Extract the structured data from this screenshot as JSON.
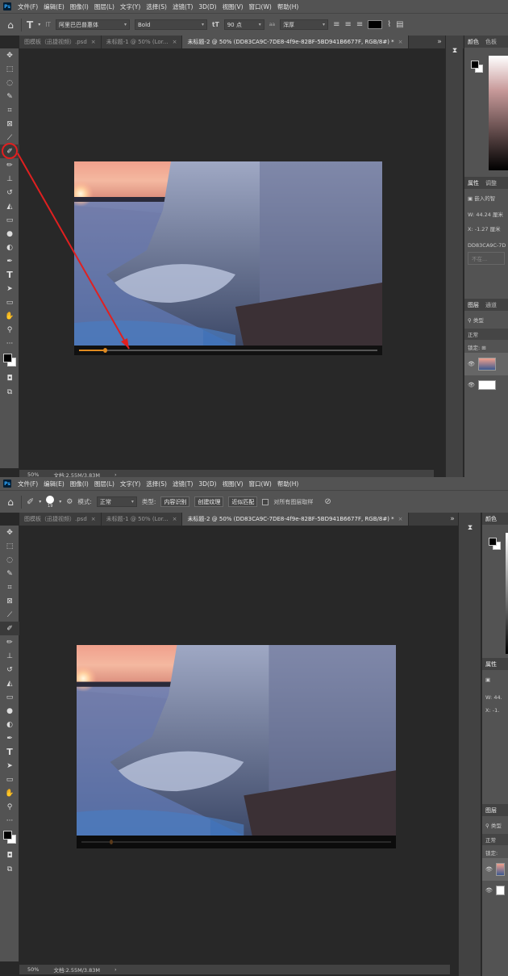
{
  "app": {
    "logo": "Ps"
  },
  "menu": [
    "文件(F)",
    "编辑(E)",
    "图像(I)",
    "图层(L)",
    "文字(Y)",
    "选择(S)",
    "滤镜(T)",
    "3D(D)",
    "视图(V)",
    "窗口(W)",
    "帮助(H)"
  ],
  "text_options": {
    "tool_icon": "T",
    "orient_icon": "IT",
    "font_family": "阿里巴巴普惠体",
    "font_style": "Bold",
    "font_size_icon": "tT",
    "font_size": "90 点",
    "aa_icon": "aa",
    "antialias": "浑厚"
  },
  "heal_options": {
    "brush_size": "19",
    "mode_label": "模式:",
    "mode": "正常",
    "type_label": "类型:",
    "type_buttons": [
      "内容识别",
      "创建纹理",
      "近似匹配"
    ],
    "sample_all": "对所有图层取样"
  },
  "tabs_top": [
    {
      "label": "图模板（迅捷视频）.psd",
      "active": false
    },
    {
      "label": "未标题-1 @ 50% (Lor...",
      "active": false
    },
    {
      "label": "未标题-2 @ 50% (DD83CA9C-7DE8-4f9e-82BF-5BD941B6677F, RGB/8#) *",
      "active": true
    }
  ],
  "tabs_bottom": [
    {
      "label": "图模板（迅捷视频）.psd",
      "active": false
    },
    {
      "label": "未标题-1 @ 50% (Lor...",
      "active": false
    },
    {
      "label": "未标题-2 @ 50% (DD83CA9C-7DE8-4f9e-82BF-5BD941B6677F, RGB/8#) *",
      "active": true
    }
  ],
  "tabs_overflow": "»",
  "status": {
    "zoom": "50%",
    "doc": "文档:2.55M/3.83M"
  },
  "panels": {
    "color_tabs": [
      "颜色",
      "色板"
    ],
    "props_tabs": [
      "属性",
      "调整"
    ],
    "props_embedded": "嵌入的智",
    "props_w_label": "W:",
    "props_w": "44.24 厘米",
    "props_x_label": "X:",
    "props_x": "-1.27 厘米",
    "props_name": "DD83CA9C-7D",
    "props_btn": "不在...",
    "layers_tabs": [
      "图层",
      "通道"
    ],
    "layers_kind": "类型",
    "layers_blend": "正常",
    "layers_lock": "锁定:"
  },
  "panels_bottom": {
    "color_tabs": [
      "颜色"
    ],
    "props_tabs": [
      "属性"
    ],
    "props_w": "44.",
    "props_x": "-1.",
    "layers_tabs": [
      "图层"
    ],
    "layers_kind": "类型",
    "layers_blend": "正常",
    "layers_lock": "锁定:"
  },
  "colors": {
    "accent_red": "#e02020",
    "progress": "#e08a20"
  }
}
